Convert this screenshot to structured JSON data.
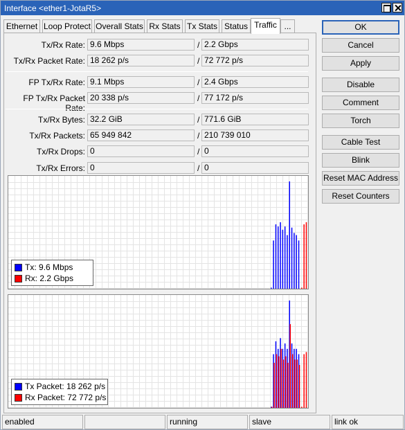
{
  "window": {
    "title": "Interface <ether1-JotaR5>"
  },
  "tabs": [
    {
      "label": "Ethernet",
      "active": false
    },
    {
      "label": "Loop Protect",
      "active": false
    },
    {
      "label": "Overall Stats",
      "active": false
    },
    {
      "label": "Rx Stats",
      "active": false
    },
    {
      "label": "Tx Stats",
      "active": false
    },
    {
      "label": "Status",
      "active": false
    },
    {
      "label": "Traffic",
      "active": true
    },
    {
      "label": "...",
      "active": false
    }
  ],
  "fields": {
    "txrx_rate": {
      "label": "Tx/Rx Rate:",
      "tx": "9.6 Mbps",
      "rx": "2.2 Gbps"
    },
    "txrx_packet_rate": {
      "label": "Tx/Rx Packet Rate:",
      "tx": "18 262 p/s",
      "rx": "72 772 p/s"
    },
    "fp_txrx_rate": {
      "label": "FP Tx/Rx Rate:",
      "tx": "9.1 Mbps",
      "rx": "2.4 Gbps"
    },
    "fp_txrx_packet_rate": {
      "label": "FP Tx/Rx Packet Rate:",
      "tx": "20 338 p/s",
      "rx": "77 172 p/s"
    },
    "txrx_bytes": {
      "label": "Tx/Rx Bytes:",
      "tx": "32.2 GiB",
      "rx": "771.6 GiB"
    },
    "txrx_packets": {
      "label": "Tx/Rx Packets:",
      "tx": "65 949 842",
      "rx": "210 739 010"
    },
    "txrx_drops": {
      "label": "Tx/Rx Drops:",
      "tx": "0",
      "rx": "0"
    },
    "txrx_errors": {
      "label": "Tx/Rx Errors:",
      "tx": "0",
      "rx": "0"
    },
    "separator": "/"
  },
  "buttons": {
    "ok": "OK",
    "cancel": "Cancel",
    "apply": "Apply",
    "disable": "Disable",
    "comment": "Comment",
    "torch": "Torch",
    "cable_test": "Cable Test",
    "blink": "Blink",
    "reset_mac": "Reset MAC Address",
    "reset_counters": "Reset Counters"
  },
  "graphs": {
    "traffic": {
      "legend": [
        {
          "label": "Tx:",
          "value": "9.6 Mbps",
          "color": "#0000ff"
        },
        {
          "label": "Rx:",
          "value": "2.2 Gbps",
          "color": "#ff0000"
        }
      ]
    },
    "packets": {
      "legend": [
        {
          "label": "Tx Packet:",
          "value": "18 262 p/s",
          "color": "#0000ff"
        },
        {
          "label": "Rx Packet:",
          "value": "72 772 p/s",
          "color": "#ff0000"
        }
      ]
    }
  },
  "chart_data": [
    {
      "type": "bar",
      "series": [
        {
          "name": "Tx",
          "color": "#0000ff",
          "values": [
            0,
            0,
            0,
            0,
            0,
            0,
            0,
            0,
            0,
            0,
            0,
            0,
            0,
            0,
            0,
            0,
            0,
            0,
            0,
            0,
            0,
            0,
            0,
            0,
            0,
            0,
            0,
            0,
            0,
            0,
            0,
            0,
            0,
            0,
            0,
            0,
            0,
            0,
            0,
            0,
            0,
            0,
            0.01,
            0.45,
            0.6,
            0.58,
            0.62,
            0.55,
            0.58,
            0.5,
            1.0,
            0.57,
            0.52,
            0.5,
            0.45,
            0,
            0,
            0,
            0
          ]
        },
        {
          "name": "Rx",
          "color": "#ff0000",
          "values": [
            0,
            0,
            0,
            0,
            0,
            0,
            0,
            0,
            0,
            0,
            0,
            0,
            0,
            0,
            0,
            0,
            0,
            0,
            0,
            0,
            0,
            0,
            0,
            0,
            0,
            0,
            0,
            0,
            0,
            0,
            0,
            0,
            0,
            0,
            0,
            0,
            0,
            0,
            0,
            0,
            0,
            0,
            0,
            0,
            0,
            0,
            0,
            0,
            0,
            0,
            0,
            0,
            0,
            0,
            0,
            0.01,
            0.6,
            0.62,
            0.58
          ]
        }
      ]
    },
    {
      "type": "bar",
      "series": [
        {
          "name": "Tx Packet",
          "color": "#0000ff",
          "values": [
            0,
            0,
            0,
            0,
            0,
            0,
            0,
            0,
            0,
            0,
            0,
            0,
            0,
            0,
            0,
            0,
            0,
            0,
            0,
            0,
            0,
            0,
            0,
            0,
            0,
            0,
            0,
            0,
            0,
            0,
            0,
            0,
            0,
            0,
            0,
            0,
            0,
            0,
            0,
            0,
            0,
            0,
            0.01,
            0.5,
            0.62,
            0.55,
            0.65,
            0.55,
            0.6,
            0.55,
            1.0,
            0.6,
            0.55,
            0.55,
            0.5,
            0,
            0,
            0,
            0
          ]
        },
        {
          "name": "Rx Packet",
          "color": "#ff0000",
          "values": [
            0,
            0,
            0,
            0,
            0,
            0,
            0,
            0,
            0,
            0,
            0,
            0,
            0,
            0,
            0,
            0,
            0,
            0,
            0,
            0,
            0,
            0,
            0,
            0,
            0,
            0,
            0,
            0,
            0,
            0,
            0,
            0,
            0,
            0,
            0,
            0,
            0,
            0,
            0,
            0,
            0,
            0,
            0.01,
            0.42,
            0.5,
            0.48,
            0.55,
            0.45,
            0.48,
            0.42,
            0.78,
            0.5,
            0.45,
            0.45,
            0.4,
            0.01,
            0.5,
            0.52,
            0.45
          ]
        }
      ]
    }
  ],
  "statusbar": [
    "enabled",
    "",
    "running",
    "slave",
    "link ok"
  ]
}
